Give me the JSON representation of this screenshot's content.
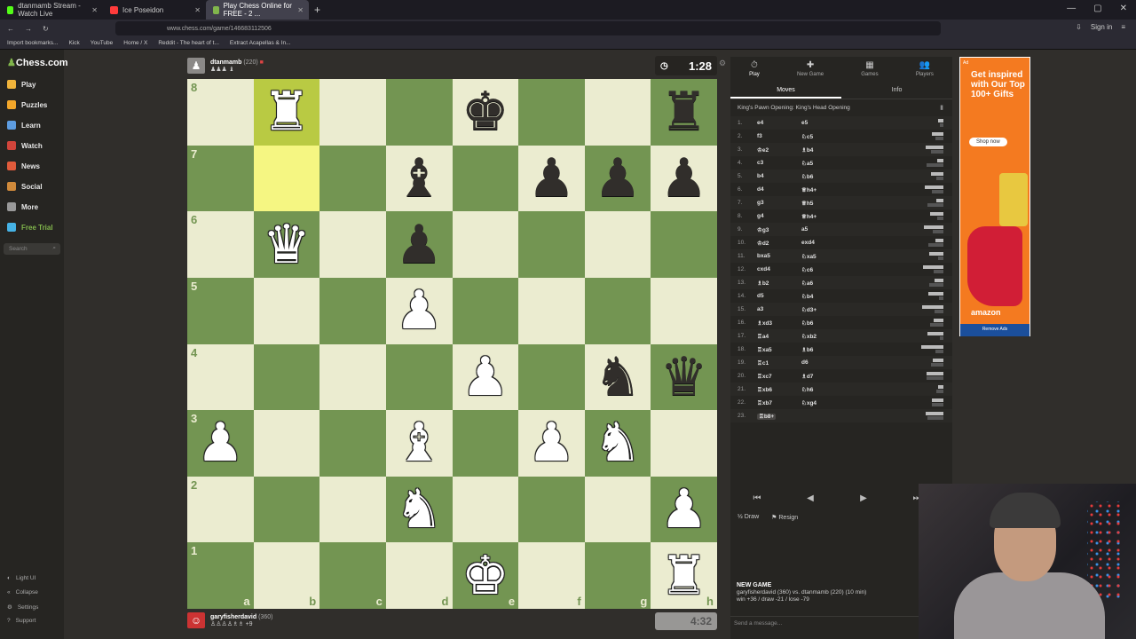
{
  "browser": {
    "tabs": [
      {
        "label": "dtanmamb Stream - Watch Live",
        "color": "#53fc18"
      },
      {
        "label": "Ice Poseidon",
        "color": "#ff3b3b"
      },
      {
        "label": "Play Chess Online for FREE - 2 ...",
        "color": "#81b64c"
      }
    ],
    "url": "www.chess.com/game/146683112506",
    "sign_in": "Sign in",
    "bookmarks": [
      "Import bookmarks...",
      "Kick",
      "YouTube",
      "Home / X",
      "Reddit - The heart of t...",
      "Extract Acapellas & In..."
    ]
  },
  "sidebar": {
    "logo": "Chess.com",
    "items": [
      "Play",
      "Puzzles",
      "Learn",
      "Watch",
      "News",
      "Social",
      "More",
      "Free Trial"
    ],
    "search_placeholder": "Search",
    "footer": [
      "Light UI",
      "Collapse",
      "Settings",
      "Support"
    ]
  },
  "top_player": {
    "name": "dtanmamb",
    "rating": "(220)",
    "material": "♟♟♟ ♝",
    "clock": "1:28"
  },
  "bottom_player": {
    "name": "garyfisherdavid",
    "rating": "(360)",
    "material": "♙♙♙♙♗♗ +9",
    "clock": "4:32"
  },
  "board": {
    "ranks": [
      "8",
      "7",
      "6",
      "5",
      "4",
      "3",
      "2",
      "1"
    ],
    "files": [
      "a",
      "b",
      "c",
      "d",
      "e",
      "f",
      "g",
      "h"
    ],
    "position": [
      [
        "",
        "wR",
        "",
        "",
        "bK",
        "",
        "",
        "bR"
      ],
      [
        "",
        "",
        "",
        "bB",
        "",
        "bP",
        "bP",
        "bP"
      ],
      [
        "",
        "wQ",
        "",
        "bP",
        "",
        "",
        "",
        ""
      ],
      [
        "",
        "",
        "",
        "wP",
        "",
        "",
        "",
        ""
      ],
      [
        "",
        "",
        "",
        "",
        "wP",
        "",
        "bN",
        "bQ"
      ],
      [
        "wP",
        "",
        "",
        "wB",
        "",
        "wP",
        "wN",
        ""
      ],
      [
        "",
        "",
        "",
        "wN",
        "",
        "",
        "",
        "wP"
      ],
      [
        "",
        "",
        "",
        "",
        "wK",
        "",
        "",
        "wR"
      ]
    ],
    "highlight": [
      [
        0,
        1
      ],
      [
        1,
        1
      ]
    ]
  },
  "panel": {
    "tabs": [
      {
        "label": "Play",
        "icon": "⏱"
      },
      {
        "label": "New Game",
        "icon": "✚"
      },
      {
        "label": "Games",
        "icon": "▦"
      },
      {
        "label": "Players",
        "icon": "👥"
      }
    ],
    "subtabs": [
      "Moves",
      "Info"
    ],
    "opening": "King's Pawn Opening: King's Head Opening",
    "moves": [
      {
        "n": "1.",
        "w": "e4",
        "b": "e5"
      },
      {
        "n": "2.",
        "w": "f3",
        "b": "♘c5"
      },
      {
        "n": "3.",
        "w": "♔e2",
        "b": "♗b4"
      },
      {
        "n": "4.",
        "w": "c3",
        "b": "♘a5"
      },
      {
        "n": "5.",
        "w": "b4",
        "b": "♘b6"
      },
      {
        "n": "6.",
        "w": "d4",
        "b": "♕h4+"
      },
      {
        "n": "7.",
        "w": "g3",
        "b": "♕h5"
      },
      {
        "n": "8.",
        "w": "g4",
        "b": "♕h4+"
      },
      {
        "n": "9.",
        "w": "♔g3",
        "b": "a5"
      },
      {
        "n": "10.",
        "w": "♔d2",
        "b": "exd4"
      },
      {
        "n": "11.",
        "w": "bxa5",
        "b": "♘xa5"
      },
      {
        "n": "12.",
        "w": "cxd4",
        "b": "♘c6"
      },
      {
        "n": "13.",
        "w": "♗b2",
        "b": "♘a6"
      },
      {
        "n": "14.",
        "w": "d5",
        "b": "♘b4"
      },
      {
        "n": "15.",
        "w": "a3",
        "b": "♘d3+"
      },
      {
        "n": "16.",
        "w": "♗xd3",
        "b": "♘b6"
      },
      {
        "n": "17.",
        "w": "♖a4",
        "b": "♘xb2"
      },
      {
        "n": "18.",
        "w": "♖xa5",
        "b": "♗b6"
      },
      {
        "n": "19.",
        "w": "♖c1",
        "b": "d6"
      },
      {
        "n": "20.",
        "w": "♖xc7",
        "b": "♗d7"
      },
      {
        "n": "21.",
        "w": "♖xb6",
        "b": "♘h6"
      },
      {
        "n": "22.",
        "w": "♖xb7",
        "b": "♘xg4"
      },
      {
        "n": "23.",
        "w": "♖b8+",
        "b": ""
      }
    ],
    "controls": [
      "⏮",
      "◀",
      "▶",
      "⏭"
    ],
    "draw": "Draw",
    "resign": "Resign",
    "new_game_title": "NEW GAME",
    "new_game_line1": "garyfisherdavid (360) vs. dtanmamb (220) (10 min)",
    "new_game_line2": "win +36 / draw -21 / lose -79",
    "chat_placeholder": "Send a message..."
  },
  "ad": {
    "label": "Ad",
    "headline": "Get inspired with Our Top 100+ Gifts",
    "button": "Shop now",
    "brand": "amazon",
    "remove": "Remove Ads"
  }
}
